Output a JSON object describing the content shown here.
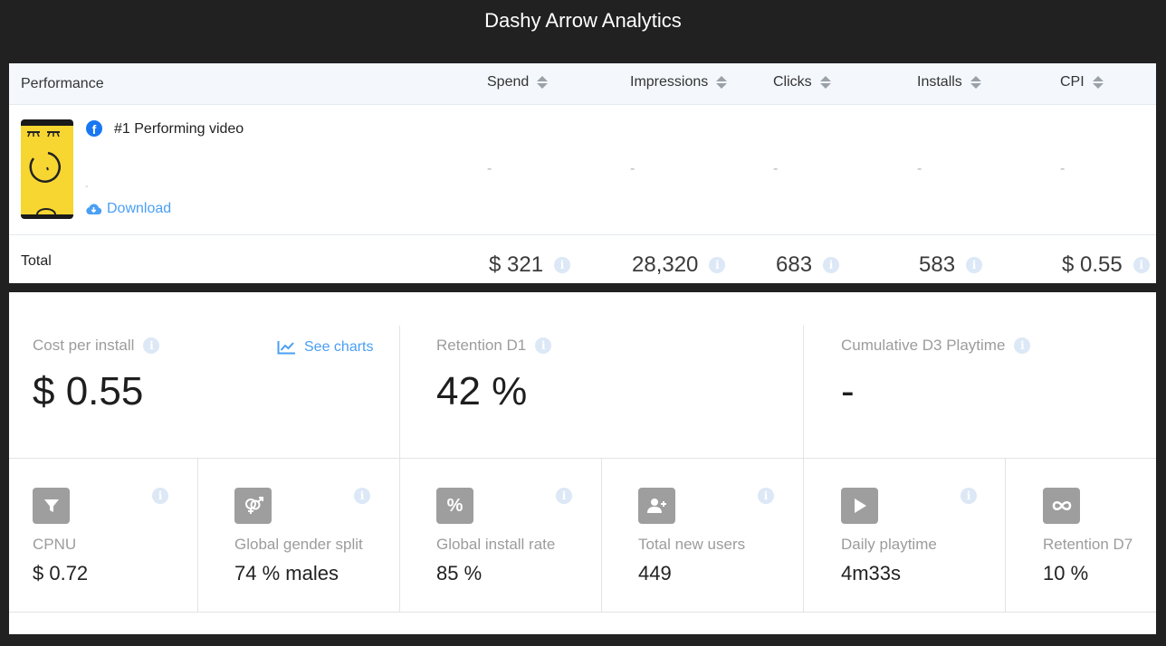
{
  "app_title": "Dashy Arrow Analytics",
  "performance_table": {
    "columns": [
      {
        "label": "Performance",
        "sortable": false
      },
      {
        "label": "Spend",
        "sortable": true
      },
      {
        "label": "Impressions",
        "sortable": true
      },
      {
        "label": "Clicks",
        "sortable": true
      },
      {
        "label": "Installs",
        "sortable": true
      },
      {
        "label": "CPI",
        "sortable": true
      }
    ],
    "video_row": {
      "platform_icon": "facebook-icon",
      "title": "#1 Performing video",
      "subtitle": "-",
      "download_label": "Download",
      "values": [
        "-",
        "-",
        "-",
        "-",
        "-"
      ]
    },
    "total_row": {
      "label": "Total",
      "values": [
        "$ 321",
        "28,320",
        "683",
        "583",
        "$ 0.55"
      ]
    }
  },
  "stats": {
    "big_cards": [
      {
        "label": "Cost per install",
        "value": "$ 0.55",
        "link": "See charts"
      },
      {
        "label": "Retention D1",
        "value": "42 %"
      },
      {
        "label": "Cumulative D3 Playtime",
        "value": "-"
      }
    ],
    "small_cards": [
      {
        "icon": "filter-icon",
        "label": "CPNU",
        "value": "$ 0.72"
      },
      {
        "icon": "gender-icon",
        "label": "Global gender split",
        "value": "74 % males"
      },
      {
        "icon": "percent-icon",
        "label": "Global install rate",
        "value": "85 %"
      },
      {
        "icon": "add-user-icon",
        "label": "Total new users",
        "value": "449"
      },
      {
        "icon": "play-icon",
        "label": "Daily playtime",
        "value": "4m33s"
      },
      {
        "icon": "infinity-icon",
        "label": "Retention D7",
        "value": "10 %"
      }
    ]
  },
  "colors": {
    "background": "#212121",
    "link": "#4a9ff5",
    "facebook": "#1877f2",
    "thumbnail": "#f7d631",
    "icon_tile": "#9e9e9e"
  }
}
